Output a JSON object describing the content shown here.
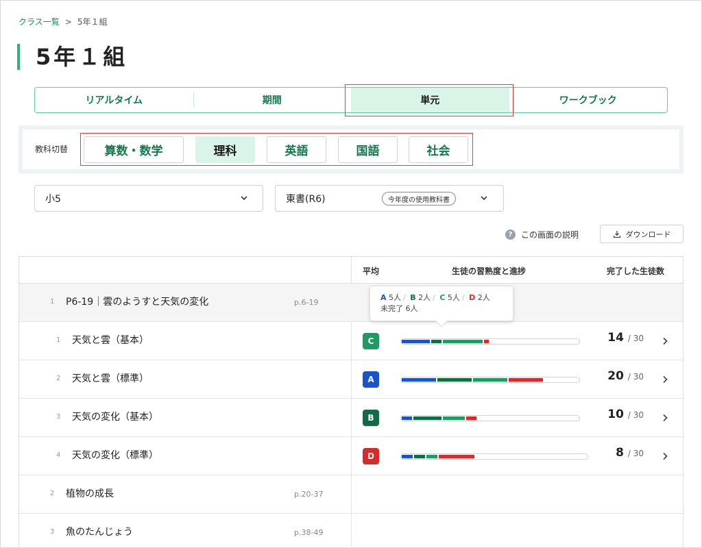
{
  "breadcrumb": {
    "link": "クラス一覧",
    "separator": ">",
    "current": "5年１組"
  },
  "page_title": "5年１組",
  "tabs": [
    {
      "label": "リアルタイム",
      "active": false
    },
    {
      "label": "期間",
      "active": false
    },
    {
      "label": "単元",
      "active": true
    },
    {
      "label": "ワークブック",
      "active": false
    }
  ],
  "subject_switch": {
    "label": "教科切替",
    "subjects": [
      {
        "label": "算数・数学",
        "active": false
      },
      {
        "label": "理科",
        "active": true
      },
      {
        "label": "英語",
        "active": false
      },
      {
        "label": "国語",
        "active": false
      },
      {
        "label": "社会",
        "active": false
      }
    ]
  },
  "grade_select": {
    "value": "小5",
    "icon": "chevron-down-icon"
  },
  "textbook_select": {
    "value": "東書(R6)",
    "badge": "今年度の使用教科書",
    "icon": "chevron-down-icon"
  },
  "help": {
    "icon": "question-icon",
    "label": "この画面の説明"
  },
  "download": {
    "icon": "download-icon",
    "label": "ダウンロード"
  },
  "table_headers": {
    "average": "平均",
    "progress": "生徒の習熟度と進捗",
    "completed": "完了した生徒数"
  },
  "colors": {
    "A": "#1a55c8",
    "B": "#136b44",
    "C": "#1f9a63",
    "D": "#d42c2c",
    "accent": "#2bb37a"
  },
  "tooltip": {
    "A_label": "A",
    "A_count": "5人",
    "B_label": "B",
    "B_count": "2人",
    "C_label": "C",
    "C_count": "5人",
    "D_label": "D",
    "D_count": "2人",
    "incomplete": "未完了 6人"
  },
  "units": [
    {
      "number": "1",
      "title": "P6-19｜雲のようすと天気の変化",
      "pages": "p.6-19",
      "expanded": true,
      "lessons": [
        {
          "number": "1",
          "title": "天気と雲（基本）",
          "grade": "C",
          "completed": "14",
          "total": "/ 30",
          "progress": {
            "A": 5,
            "B": 2,
            "C": 7,
            "D": 1,
            "total": 30
          }
        },
        {
          "number": "2",
          "title": "天気と雲（標準）",
          "grade": "A",
          "completed": "20",
          "total": "/ 30",
          "progress": {
            "A": 6,
            "B": 6,
            "C": 6,
            "D": 6,
            "total": 30
          }
        },
        {
          "number": "3",
          "title": "天気の変化（基本）",
          "grade": "B",
          "completed": "10",
          "total": "/ 30",
          "progress": {
            "A": 2,
            "B": 5,
            "C": 4,
            "D": 2,
            "total": 30
          }
        },
        {
          "number": "4",
          "title": "天気の変化（標準）",
          "grade": "D",
          "completed": "8",
          "total": "/ 30",
          "progress": {
            "A": 2,
            "B": 2,
            "C": 2,
            "D": 6,
            "total": 30
          }
        }
      ]
    },
    {
      "number": "2",
      "title": "植物の成長",
      "pages": "p.20-37",
      "expanded": false
    },
    {
      "number": "3",
      "title": "魚のたんじょう",
      "pages": "p.38-49",
      "expanded": false
    }
  ]
}
